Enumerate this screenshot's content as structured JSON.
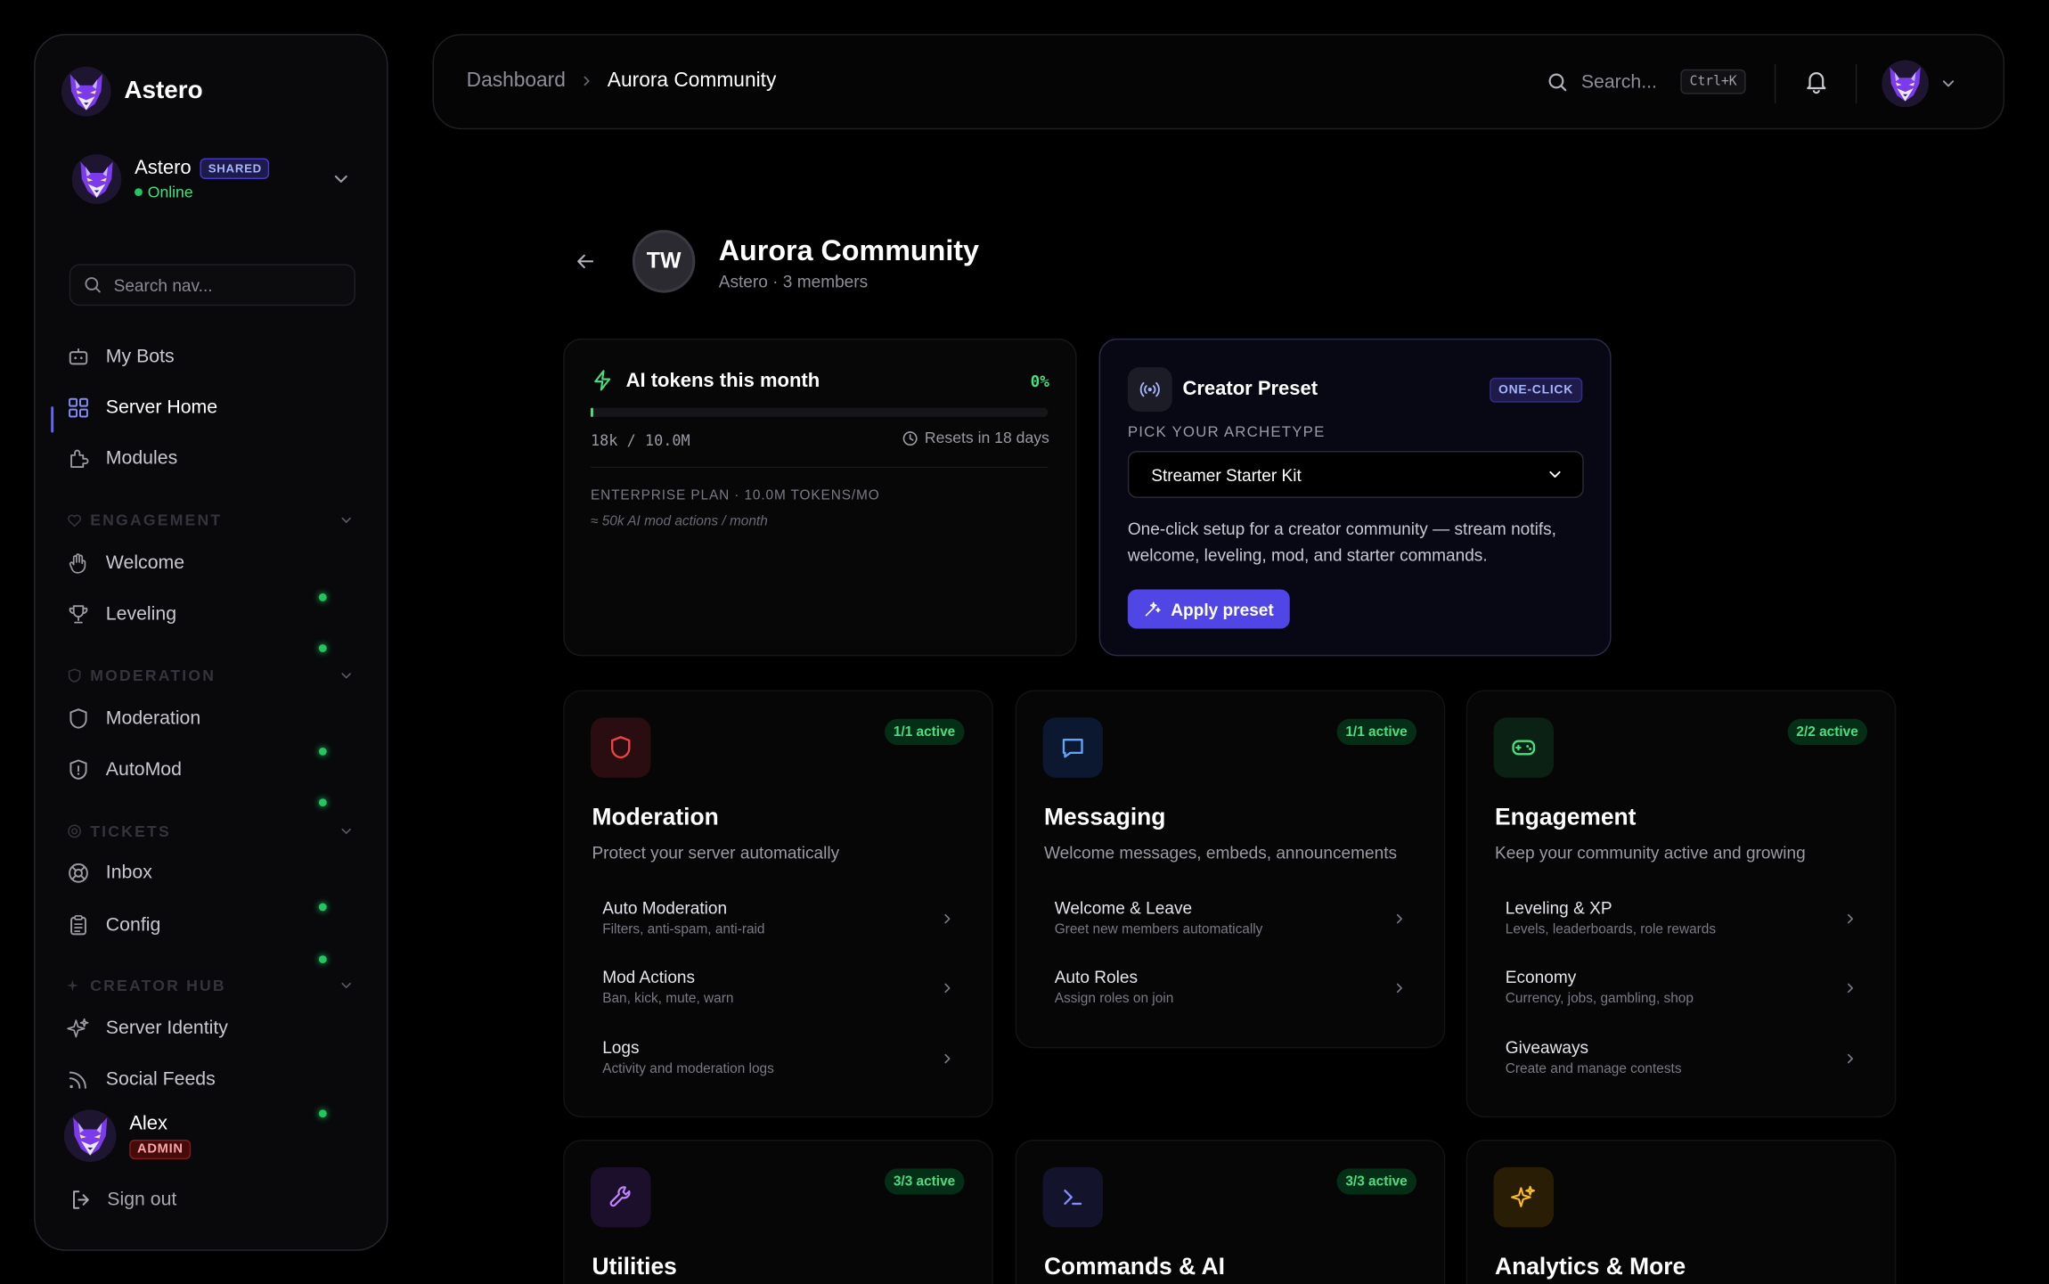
{
  "sidebar": {
    "brand": "Astero",
    "bot": {
      "name": "Astero",
      "badge": "SHARED",
      "status": "Online"
    },
    "search_placeholder": "Search nav...",
    "items_top": [
      {
        "label": "My Bots",
        "icon": "bot-icon"
      },
      {
        "label": "Server Home",
        "icon": "grid-icon",
        "active": true
      },
      {
        "label": "Modules",
        "icon": "puzzle-icon"
      }
    ],
    "sections": [
      {
        "title": "ENGAGEMENT",
        "icon": "heart-icon",
        "items": [
          {
            "label": "Welcome",
            "icon": "wave-hand-icon",
            "enabled": true
          },
          {
            "label": "Leveling",
            "icon": "trophy-icon",
            "enabled": true
          }
        ]
      },
      {
        "title": "MODERATION",
        "icon": "shield-icon",
        "items": [
          {
            "label": "Moderation",
            "icon": "shield-icon",
            "enabled": true
          },
          {
            "label": "AutoMod",
            "icon": "shield-alert-icon",
            "enabled": true
          }
        ]
      },
      {
        "title": "TICKETS",
        "icon": "lifebuoy-icon",
        "items": [
          {
            "label": "Inbox",
            "icon": "lifebuoy-icon",
            "enabled": true
          },
          {
            "label": "Config",
            "icon": "clipboard-icon",
            "enabled": true
          }
        ]
      },
      {
        "title": "CREATOR HUB",
        "icon": "sparkles-icon",
        "items": [
          {
            "label": "Server Identity",
            "icon": "sparkles-icon",
            "enabled": false
          },
          {
            "label": "Social Feeds",
            "icon": "rss-icon",
            "enabled": true
          }
        ]
      }
    ],
    "user": {
      "name": "Alex",
      "role": "ADMIN"
    },
    "signout": "Sign out"
  },
  "topbar": {
    "breadcrumb": [
      "Dashboard",
      "Aurora Community"
    ],
    "search_placeholder": "Search...",
    "shortcut": "Ctrl+K"
  },
  "server": {
    "initials": "TW",
    "name": "Aurora Community",
    "subtitle": "Astero · 3 members"
  },
  "tokens": {
    "title": "AI tokens this month",
    "percent": "0%",
    "fill": 0.0018,
    "used": "18k / 10.0M",
    "reset": "Resets in 18 days",
    "plan": "ENTERPRISE PLAN · 10.0M TOKENS/MO",
    "estimate": "≈ 50k AI mod actions / month"
  },
  "preset": {
    "title": "Creator Preset",
    "badge": "ONE-CLICK",
    "label": "PICK YOUR ARCHETYPE",
    "selected": "Streamer Starter Kit",
    "description": "One-click setup for a creator community — stream notifs, welcome, leveling, mod, and starter commands.",
    "button": "Apply preset"
  },
  "modules": [
    {
      "title": "Moderation",
      "active": "1/1 active",
      "description": "Protect your server automatically",
      "icon": "shield-icon",
      "color": "#ef4444",
      "bg": "#2a0d10",
      "rows": [
        {
          "title": "Auto Moderation",
          "sub": "Filters, anti-spam, anti-raid"
        },
        {
          "title": "Mod Actions",
          "sub": "Ban, kick, mute, warn"
        },
        {
          "title": "Logs",
          "sub": "Activity and moderation logs"
        }
      ]
    },
    {
      "title": "Messaging",
      "active": "1/1 active",
      "description": "Welcome messages, embeds, announcements",
      "icon": "message-icon",
      "color": "#60a5fa",
      "bg": "#0c1830",
      "rows": [
        {
          "title": "Welcome & Leave",
          "sub": "Greet new members automatically"
        },
        {
          "title": "Auto Roles",
          "sub": "Assign roles on join"
        }
      ]
    },
    {
      "title": "Engagement",
      "active": "2/2 active",
      "description": "Keep your community active and growing",
      "icon": "gamepad-icon",
      "color": "#4ade80",
      "bg": "#0a2114",
      "rows": [
        {
          "title": "Leveling & XP",
          "sub": "Levels, leaderboards, role rewards"
        },
        {
          "title": "Economy",
          "sub": "Currency, jobs, gambling, shop"
        },
        {
          "title": "Giveaways",
          "sub": "Create and manage contests"
        }
      ]
    },
    {
      "title": "Utilities",
      "active": "3/3 active",
      "icon": "wrench-icon",
      "color": "#c084fc",
      "bg": "#1c0f2c"
    },
    {
      "title": "Commands & AI",
      "active": "3/3 active",
      "icon": "terminal-icon",
      "color": "#818cf8",
      "bg": "#13132c"
    },
    {
      "title": "Analytics & More",
      "icon": "sparkles-icon",
      "color": "#fbbf24",
      "bg": "#2a1d06"
    }
  ],
  "colors": {
    "accent": "#4f46e5",
    "success": "#22c55e",
    "danger": "#ef4444",
    "background": "#000000"
  }
}
